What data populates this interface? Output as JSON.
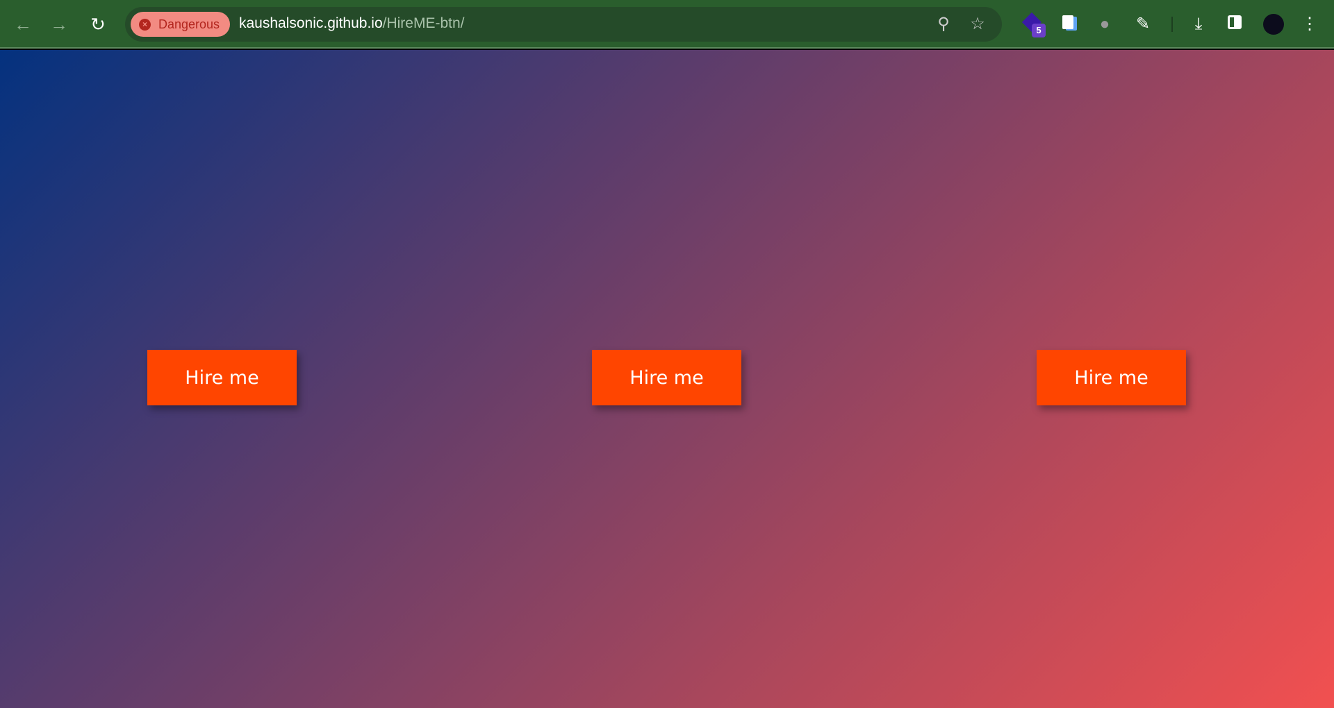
{
  "browser": {
    "security_chip": "Dangerous",
    "url_host": "kaushalsonic.github.io",
    "url_path": "/HireME-btn/",
    "extension_badge": "5",
    "icons": [
      "back-icon",
      "forward-icon",
      "reload-icon",
      "zoom-icon",
      "star-icon",
      "extension-icon",
      "puzzle-icon",
      "download-icon",
      "sidepanel-icon",
      "profile-avatar",
      "menu-icon"
    ]
  },
  "page": {
    "background_colors": [
      "#04327f",
      "#f25050"
    ],
    "button_color": "#ff4500",
    "buttons": [
      {
        "label": "Hire me"
      },
      {
        "label": "Hire me"
      },
      {
        "label": "Hire me"
      }
    ]
  }
}
